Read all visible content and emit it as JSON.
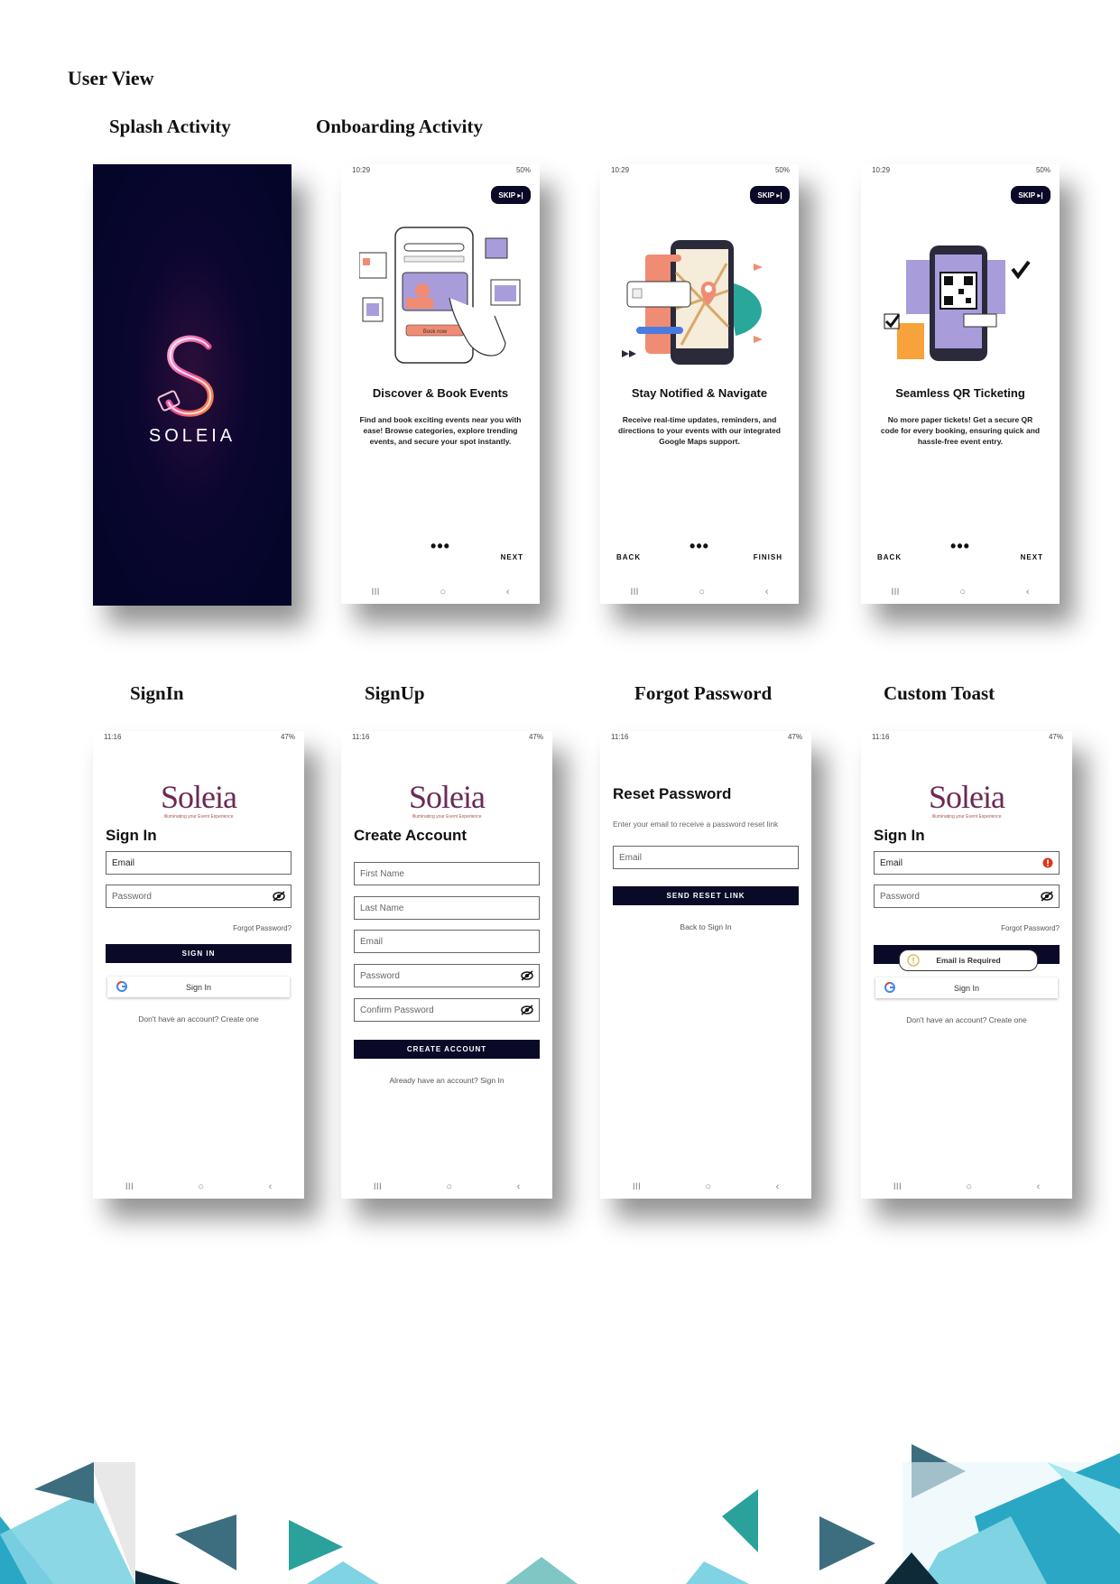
{
  "page": {
    "title": "User View"
  },
  "labels": {
    "splash": "Splash Activity",
    "onboarding": "Onboarding Activity",
    "signin": "SignIn",
    "signup": "SignUp",
    "forgot": "Forgot Password",
    "toast": "Custom Toast"
  },
  "colors": {
    "splash_bg": "#05052a",
    "primary": "#0a0a28",
    "logo": "#6b2a55",
    "accent": "#f08c73",
    "lavender": "#a99cdb",
    "teal": "#2aa79b"
  },
  "splash": {
    "brand": "SOLEIA",
    "letter": "S"
  },
  "onboard": [
    {
      "status_time": "10:29",
      "status_right": "50%",
      "skip": "SKIP",
      "title": "Discover & Book Events",
      "desc": "Find and book exciting events near you with ease! Browse categories, explore trending events, and secure your spot instantly.",
      "back": "",
      "next": "NEXT",
      "dots": "•••",
      "book_now": "Book now"
    },
    {
      "status_time": "10:29",
      "status_right": "50%",
      "skip": "SKIP",
      "title": "Stay Notified & Navigate",
      "desc": "Receive real-time updates, reminders, and directions to your events with our integrated Google Maps support.",
      "back": "BACK",
      "next": "FINISH",
      "dots": "•••"
    },
    {
      "status_time": "10:29",
      "status_right": "50%",
      "skip": "SKIP",
      "title": "Seamless QR Ticketing",
      "desc": "No more paper tickets! Get a secure QR code for every booking, ensuring quick and hassle-free event entry.",
      "back": "BACK",
      "next": "NEXT",
      "dots": "•••"
    }
  ],
  "auth": {
    "status_time": "11:16",
    "status_right": "47%",
    "logo": "Soleia",
    "logo_sub": "Illuminating your Event Experience",
    "signin": {
      "heading": "Sign In",
      "email": "Email",
      "password": "Password",
      "forgot": "Forgot Password?",
      "button": "SIGN IN",
      "google": "Sign In",
      "footer": "Don't have an account? Create one"
    },
    "signup": {
      "heading": "Create Account",
      "first": "First Name",
      "last": "Last Name",
      "email": "Email",
      "password": "Password",
      "confirm": "Confirm Password",
      "button": "CREATE ACCOUNT",
      "footer": "Already have an account? Sign In"
    },
    "reset": {
      "heading": "Reset Password",
      "hint": "Enter your email to receive a password reset link",
      "email": "Email",
      "button": "SEND RESET LINK",
      "back": "Back to Sign In"
    },
    "toast": {
      "message": "Email is Required"
    }
  },
  "nav": {
    "recents": "III",
    "home": "○",
    "back": "‹"
  }
}
